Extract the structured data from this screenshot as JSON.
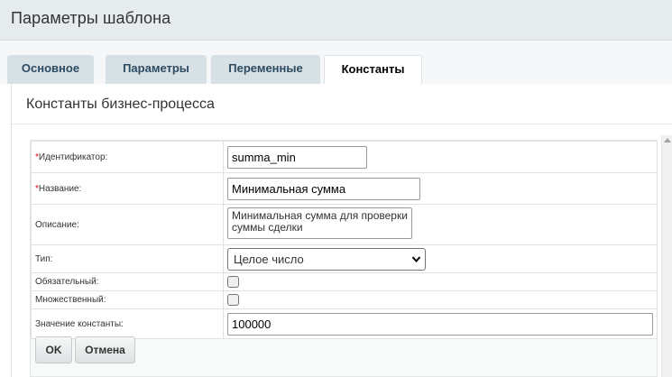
{
  "header": {
    "title": "Параметры шаблона"
  },
  "tabs": [
    {
      "label": "Основное",
      "active": false
    },
    {
      "label": "Параметры",
      "active": false
    },
    {
      "label": "Переменные",
      "active": false
    },
    {
      "label": "Константы",
      "active": true
    }
  ],
  "section": {
    "title": "Константы бизнес-процесса"
  },
  "form": {
    "identifier": {
      "label": "Идентификатор:",
      "required_mark": "*",
      "value": "summa_min"
    },
    "name": {
      "label": "Название:",
      "required_mark": "*",
      "value": "Минимальная сумма"
    },
    "description": {
      "label": "Описание:",
      "value": "Минимальная сумма для проверки суммы сделки"
    },
    "type": {
      "label": "Тип:",
      "value": "Целое число"
    },
    "required": {
      "label": "Обязательный:",
      "checked": false
    },
    "multiple": {
      "label": "Множественный:",
      "checked": false
    },
    "constant_value": {
      "label": "Значение константы:",
      "value": "100000"
    }
  },
  "buttons": {
    "ok": "OK",
    "cancel": "Отмена"
  },
  "icons": {
    "select_arrow": "chevron-down-icon",
    "scroll_up": "scroll-up-arrow-icon"
  }
}
